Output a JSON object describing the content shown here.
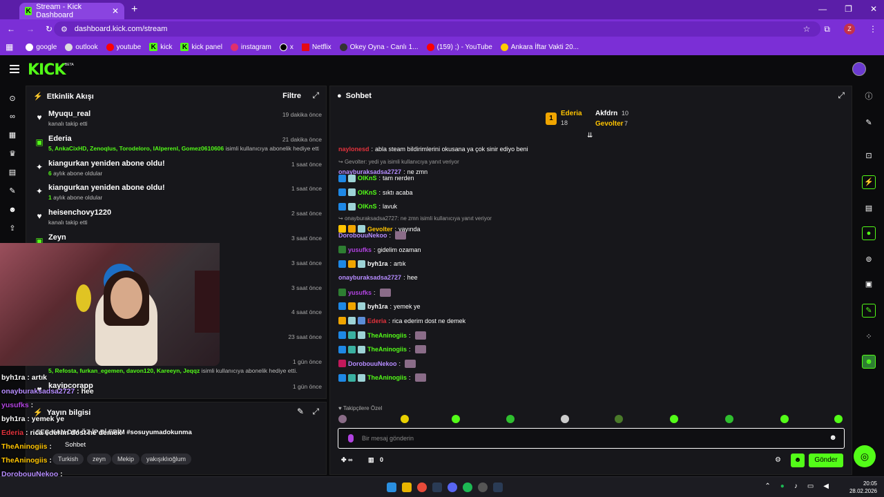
{
  "browser": {
    "tab_title": "Stream - Kick Dashboard",
    "url": "dashboard.kick.com/stream",
    "profile_initial": "Z",
    "bookmarks": [
      "google",
      "outlook",
      "youtube",
      "kick",
      "kick panel",
      "instagram",
      "x",
      "Netflix",
      "Okey Oyna - Canlı 1...",
      "(159) ;) - YouTube",
      "Ankara İftar Vakti 20..."
    ]
  },
  "kick": {
    "logo": "KICK",
    "beta": "BETA"
  },
  "activity": {
    "title": "Etkinlik Akışı",
    "filter": "Filtre",
    "items": [
      {
        "name": "Myuqu_real",
        "sub": "kanalı takip etti",
        "time": "19 dakika önce",
        "icon": "♥",
        "color": "#ffffff"
      },
      {
        "name": "Ederia",
        "sub_green": "5, AnkaCixHD, Zenoqlus, Torodeloro, IAlperenl, Gomez0610606",
        "sub": " isimli kullanıcıya abonelik hediye etti.",
        "time": "21 dakika önce",
        "icon": "▣",
        "color": "#53fc18"
      },
      {
        "name": "kiangurkan yeniden abone oldu!",
        "sub_green": "6",
        "sub": " aylık abone oldular",
        "time": "1 saat önce",
        "icon": "✦",
        "color": "#ffffff"
      },
      {
        "name": "kiangurkan yeniden abone oldu!",
        "sub_green": "1",
        "sub": " aylık abone oldular",
        "time": "1 saat önce",
        "icon": "✦",
        "color": "#ffffff"
      },
      {
        "name": "heisenchovy1220",
        "sub": "kanalı takip etti",
        "time": "2 saat önce",
        "icon": "♥",
        "color": "#ffffff"
      },
      {
        "name": "Zeyn",
        "sub": "",
        "time": "3 saat önce",
        "icon": "▣",
        "color": "#53fc18"
      },
      {
        "name": "",
        "sub": "",
        "time": "3 saat önce",
        "icon": "",
        "color": "#ffffff"
      },
      {
        "name": "",
        "sub": "",
        "time": "3 saat önce",
        "icon": "",
        "color": "#ffffff"
      },
      {
        "name": "",
        "sub": "",
        "time": "4 saat önce",
        "icon": "",
        "color": "#ffffff"
      },
      {
        "name": "",
        "sub": "",
        "time": "23 saat önce",
        "icon": "",
        "color": "#ffffff"
      },
      {
        "name": "",
        "sub_green": "5, Refosta, furkan_egemen, davon120, Kareeyn, Jeqqz",
        "sub": " isimli kullanıcıya abonelik hediye etti.",
        "time": "1 gün önce",
        "icon": "",
        "color": "#ffffff"
      },
      {
        "name": "kayipcorapp",
        "sub": "",
        "time": "1 gün önce",
        "icon": "♥",
        "color": "#ffffff"
      }
    ]
  },
  "overlay_chat": [
    {
      "user": "byh1ra",
      "color": "#ffffff",
      "msg": "artık"
    },
    {
      "user": "onayburaksadsa2727",
      "color": "#b68cff",
      "msg": "hee"
    },
    {
      "user": "yusufks",
      "color": "#b143e0",
      "msg": ""
    },
    {
      "user": "byh1ra",
      "color": "#ffffff",
      "msg": "yemek ye"
    },
    {
      "user": "Ederia",
      "color": "#e2323c",
      "msg": "rica ederim dost ne demek"
    },
    {
      "user": "TheAninogiis",
      "color": "#ffc400",
      "msg": ""
    },
    {
      "user": "TheAninogiis",
      "color": "#ffc400",
      "msg": ""
    },
    {
      "user": "DorobouuNekoo",
      "color": "#b68cff",
      "msg": ""
    },
    {
      "user": "TheAninogiis",
      "color": "#ffc400",
      "msg": ""
    }
  ],
  "stream_info": {
    "title": "Yayın bilgisi",
    "stream_title": "SEÇ KAN DIM ÖZ İP Bİ ERİM #sosuyumadokunma",
    "category": "Sohbet",
    "tags": [
      "Turkish",
      "zeyn",
      "Mekip",
      "yakışıklıoğlum"
    ]
  },
  "chat": {
    "title": "Sohbet",
    "pinned": [
      {
        "name": "Ederia",
        "count": "18",
        "rank": "1"
      },
      {
        "name": "Akfdrn",
        "count": "10",
        "rank": ""
      },
      {
        "name": "Gevolter",
        "count": "7",
        "rank": ""
      }
    ],
    "messages": [
      {
        "reply": "",
        "user": "naylonesd",
        "color": "#e2323c",
        "msg": "abla steam bildirimlerini okusana ya çok sinir ediyo beni",
        "badges": []
      },
      {
        "reply": "Gevolter: yedi ya isimli kullanıcıya yanıt veriyor",
        "user": "onayburaksadsa2727",
        "color": "#b68cff",
        "msg": "ne zmn",
        "badges": []
      },
      {
        "reply": "",
        "user": "OlKnS",
        "color": "#53fc18",
        "msg": "tam nerden",
        "badges": [
          "#1e88e5",
          "#9dd3d6"
        ]
      },
      {
        "reply": "",
        "user": "OlKnS",
        "color": "#53fc18",
        "msg": "sıktı acaba",
        "badges": [
          "#1e88e5",
          "#9dd3d6"
        ]
      },
      {
        "reply": "",
        "user": "OlKnS",
        "color": "#53fc18",
        "msg": "lavuk",
        "badges": [
          "#1e88e5",
          "#9dd3d6"
        ]
      },
      {
        "reply": "onayburaksadsa2727: ne zmn isimli kullanıcıya yanıt veriyor",
        "user": "Gevolter",
        "color": "#ffc400",
        "msg": "yayında",
        "badges": [
          "#ffc400",
          "#f0a500",
          "#9dd3d6"
        ]
      },
      {
        "reply": "",
        "user": "DorobouuNekoo",
        "color": "#b68cff",
        "msg": "",
        "badges": [],
        "emote": true
      },
      {
        "reply": "",
        "user": "yusufks",
        "color": "#b143e0",
        "msg": "gidelim ozaman",
        "badges": [
          "#2e7d32"
        ]
      },
      {
        "reply": "",
        "user": "byh1ra",
        "color": "#ffffff",
        "msg": "artık",
        "badges": [
          "#1e88e5",
          "#f0a500",
          "#9dd3d6"
        ]
      },
      {
        "reply": "",
        "user": "onayburaksadsa2727",
        "color": "#b68cff",
        "msg": "hee",
        "badges": []
      },
      {
        "reply": "",
        "user": "yusufks",
        "color": "#b143e0",
        "msg": "",
        "badges": [
          "#2e7d32"
        ],
        "emote": true
      },
      {
        "reply": "",
        "user": "byh1ra",
        "color": "#ffffff",
        "msg": "yemek ye",
        "badges": [
          "#1e88e5",
          "#f0a500",
          "#9dd3d6"
        ]
      },
      {
        "reply": "",
        "user": "Ederia",
        "color": "#e2323c",
        "msg": "rica ederim dost ne demek",
        "badges": [
          "#f0a500",
          "#9dd3d6",
          "#5b8dd6"
        ]
      },
      {
        "reply": "",
        "user": "TheAninogiis",
        "color": "#53fc18",
        "msg": "",
        "badges": [
          "#1e88e5",
          "#3ab0a0",
          "#9dd3d6"
        ],
        "emote": true
      },
      {
        "reply": "",
        "user": "TheAninogiis",
        "color": "#53fc18",
        "msg": "",
        "badges": [
          "#1e88e5",
          "#3ab0a0",
          "#9dd3d6"
        ],
        "emote": true
      },
      {
        "reply": "",
        "user": "DorobouuNekoo",
        "color": "#b68cff",
        "msg": "",
        "badges": [
          "#c2185b"
        ],
        "emote": true
      },
      {
        "reply": "",
        "user": "TheAninogiis",
        "color": "#53fc18",
        "msg": "",
        "badges": [
          "#1e88e5",
          "#3ab0a0",
          "#9dd3d6"
        ],
        "emote": true
      }
    ],
    "followers_only": "Takipçilere Özel",
    "placeholder": "Bir mesaj gönderin",
    "send": "Gönder",
    "viewers_symbol": "∞",
    "gift_count": "0"
  },
  "taskbar": {
    "time": "20:05",
    "date": "28.02.2026"
  }
}
